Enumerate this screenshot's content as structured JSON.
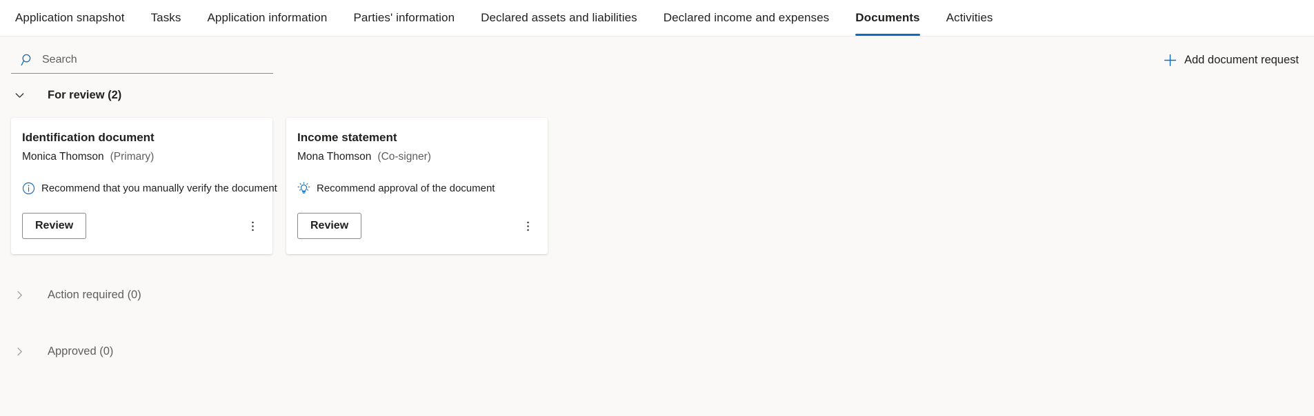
{
  "theme": {
    "accent": "#0f6cbd",
    "page_bg": "#faf9f8",
    "card_bg": "#ffffff",
    "text": "#201f1e",
    "muted_text": "#605e5c",
    "border": "#8a8886"
  },
  "tabs": [
    {
      "label": "Application snapshot",
      "active": false
    },
    {
      "label": "Tasks",
      "active": false
    },
    {
      "label": "Application information",
      "active": false
    },
    {
      "label": "Parties' information",
      "active": false
    },
    {
      "label": "Declared assets and liabilities",
      "active": false
    },
    {
      "label": "Declared income and expenses",
      "active": false
    },
    {
      "label": "Documents",
      "active": true
    },
    {
      "label": "Activities",
      "active": false
    }
  ],
  "command_bar": {
    "search": {
      "value": "",
      "placeholder": "Search",
      "icon": "search-icon"
    },
    "add_request": {
      "label": "Add document request",
      "icon": "plus-icon"
    }
  },
  "sections": [
    {
      "title": "For review (2)",
      "expanded": true,
      "chevron": "chevron-down-icon",
      "cards": [
        {
          "title": "Identification document",
          "party_name": "Monica Thomson",
          "party_role": "(Primary)",
          "note": "Recommend that you manually verify the document",
          "note_icon": "info-icon",
          "primary_action": "Review",
          "overflow_icon": "more-vertical-icon"
        },
        {
          "title": "Income statement",
          "party_name": "Mona Thomson",
          "party_role": "(Co-signer)",
          "note": "Recommend approval of the document",
          "note_icon": "lightbulb-icon",
          "primary_action": "Review",
          "overflow_icon": "more-vertical-icon"
        }
      ]
    },
    {
      "title": "Action required (0)",
      "expanded": false,
      "chevron": "chevron-right-icon",
      "cards": []
    },
    {
      "title": "Approved (0)",
      "expanded": false,
      "chevron": "chevron-right-icon",
      "cards": []
    }
  ]
}
